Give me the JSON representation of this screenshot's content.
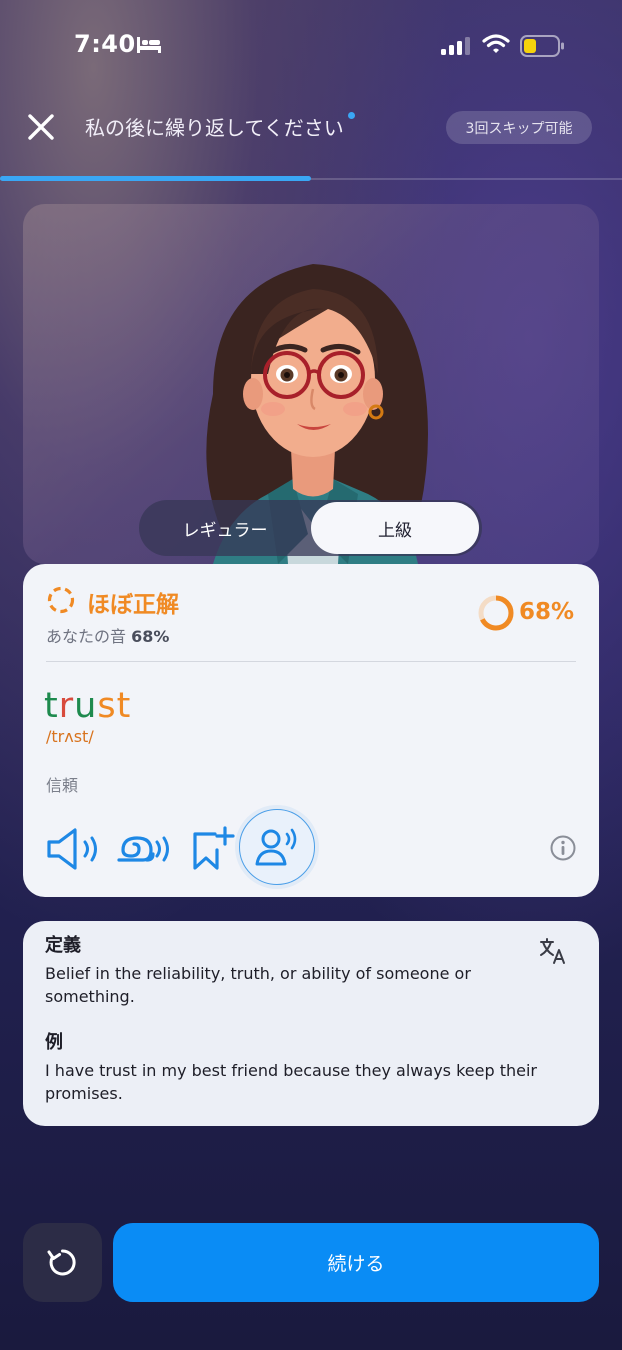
{
  "status_bar": {
    "time": "7:40"
  },
  "header": {
    "title": "私の後に繰り返してください",
    "skip_label": "3回スキップ可能",
    "progress": 0.5
  },
  "mode_toggle": {
    "options": [
      "レギュラー",
      "上級"
    ],
    "selected": "上級"
  },
  "result": {
    "status": "ほぼ正解",
    "your_sound_label": "あなたの音",
    "your_sound_value": "68%",
    "score": "68%",
    "score_value": 0.68,
    "word": {
      "letters": [
        "t",
        "r",
        "u",
        "s",
        "t"
      ],
      "colors": [
        "#1e8a4e",
        "#d84a3c",
        "#1e8a4e",
        "#f08a24",
        "#f08a24"
      ]
    },
    "ipa": "/trʌst/",
    "meaning": "信頼"
  },
  "actions": {
    "icons": [
      "speaker-icon",
      "slow-speaker-icon",
      "bookmark-add-icon",
      "voice-compare-icon",
      "info-icon"
    ]
  },
  "definition": {
    "definition_heading": "定義",
    "definition_text": "Belief in the reliability, truth, or ability of someone or something.",
    "example_heading": "例",
    "example_text": "I have trust in my best friend because they always keep their promises."
  },
  "footer": {
    "continue_label": "続ける"
  },
  "colors": {
    "accent": "#0a8cf5",
    "warning": "#f08a24",
    "progress": "#3aa7f5"
  }
}
